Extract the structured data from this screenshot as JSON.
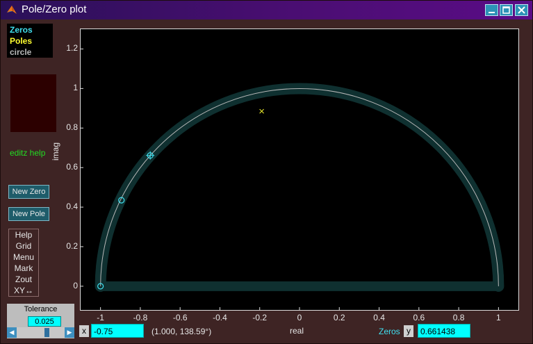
{
  "window": {
    "title": "Pole/Zero plot",
    "icon": "matlab-icon"
  },
  "legend": {
    "zeros": "Zeros",
    "poles": "Poles",
    "circle": "circle"
  },
  "colors": {
    "zeros": "#40e0f0",
    "poles": "#ffff30",
    "circle": "#b8b8b8",
    "help": "#22dd22",
    "inputs": "#00ffff",
    "tube": "#0f3030"
  },
  "sidebar": {
    "help_link": "editz help",
    "new_zero": "New Zero",
    "new_pole": "New Pole",
    "menu": [
      "Help",
      "Grid",
      "Menu",
      "Mark",
      "Zout",
      "XY↔"
    ]
  },
  "tolerance": {
    "label": "Tolerance",
    "value": "0.025"
  },
  "plot": {
    "ylabel": "imag",
    "xlabel": "real"
  },
  "chart_data": {
    "type": "scatter",
    "xlabel": "real",
    "ylabel": "imag",
    "xlim": [
      -1.1,
      1.1
    ],
    "ylim": [
      -0.12,
      1.3
    ],
    "xticks": [
      -1,
      -0.8,
      -0.6,
      -0.4,
      -0.2,
      0,
      0.2,
      0.4,
      0.6,
      0.8,
      1
    ],
    "xtick_labels": [
      "-1",
      "-0.8",
      "-0.6",
      "-0.4",
      "-0.2",
      "0",
      "0.2",
      "0.4",
      "0.6",
      "0.8",
      "1"
    ],
    "yticks": [
      0,
      0.2,
      0.4,
      0.6,
      0.8,
      1,
      1.2
    ],
    "ytick_labels": [
      "0",
      "0.2",
      "0.4",
      "0.6",
      "0.8",
      "1",
      "1.2"
    ],
    "unit_circle": true,
    "zeros": [
      {
        "x": -1.0,
        "y": 0.0
      },
      {
        "x": -0.895,
        "y": 0.435
      },
      {
        "x": -0.75,
        "y": 0.661438,
        "selected": true
      }
    ],
    "poles": [
      {
        "x": -0.19,
        "y": 0.885
      }
    ]
  },
  "status": {
    "x_label": "x",
    "x_value": "-0.75",
    "coords": "(1.000, 138.59°)",
    "mode": "Zeros",
    "y_label": "y",
    "y_value": "0.661438"
  }
}
